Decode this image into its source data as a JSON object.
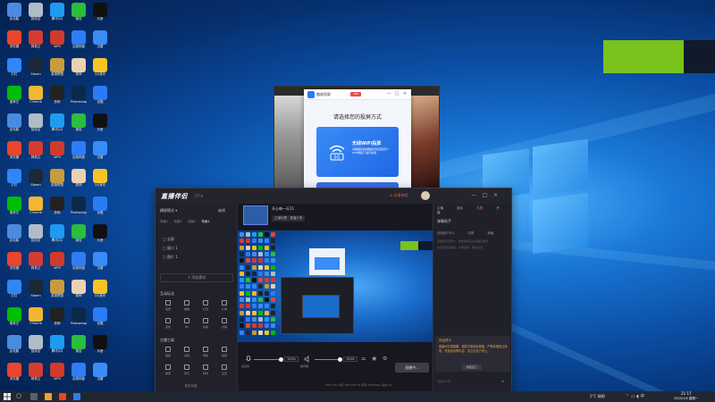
{
  "colors": {
    "accent_green": "#7ac21c",
    "live_red": "#f06a4a",
    "projection_blue": "#2a7cf6",
    "welcome_orange": "#f0a23a"
  },
  "projection_app": {
    "name": "傲软投屏",
    "badge": "VIP",
    "prompt": "请选择您的投屏方式",
    "card_title": "无线WiFi投屏",
    "card_desc": "请确保您的电脑和手机连接同一WiFi网络下进行投屏",
    "card_icon_label": "5G",
    "controls": [
      "—",
      "□",
      "×"
    ]
  },
  "live_app": {
    "logo": "直播伴侣",
    "version": "V7.6",
    "titlebar_item": "⊙ 分享伴侣",
    "controls": [
      "—",
      "□",
      "×"
    ],
    "left": {
      "scene_header": "横屏模式 ▾",
      "scene_header_right": "编辑",
      "scene_tabs": [
        "场景1",
        "场景2",
        "场景3",
        "场景4"
      ],
      "sources": [
        "▢ 全屏",
        "▢ 窗口 1",
        "▢ 图片 1"
      ],
      "add_source": "+ 添加素材",
      "interactive_title": "互动玩法",
      "interactive_tools": [
        "贴纸",
        "福袋",
        "红包",
        "礼物",
        "连线",
        "PK",
        "投票",
        "点歌"
      ],
      "anchor_title": "主播工具",
      "anchor_tools": [
        "美颜",
        "滤镜",
        "录制",
        "截屏",
        "弹幕",
        "音乐",
        "特效",
        "设置"
      ],
      "more_tools": "··· 更多功能"
    },
    "center": {
      "tab": "开心每一天11",
      "bar": "主播标题 · 直播分类",
      "mic_label": "麦克风",
      "mic_pct": "100%",
      "speaker_label": "扬声器",
      "speaker_pct": "100%",
      "start_button": "直播中...",
      "status": "CPU 23%   内存 46%   FPS 30   码率 2500kbps   丢帧 0%"
    },
    "right": {
      "tabs": [
        "主播",
        "观众",
        "礼物",
        "开播"
      ],
      "header": "弹幕助手",
      "subtabs": [
        "在线用户(0)",
        "礼物",
        "贡献"
      ],
      "line1": "直播间暂无用户，快去邀请好友来看直播吧",
      "line2": "欢迎来到直播间，文明发言，理性交流",
      "welcome_title": "欢迎提示",
      "welcome_text": "直播间文明提醒：倡导文明绿色直播，严禁传播违法违规、低俗色情等内容，请注意言行举止。",
      "welcome_button": "我知道了",
      "input_placeholder": "说点什么吧...",
      "send": "➤"
    }
  },
  "desktop_icons": [
    {
      "label": "此电脑",
      "color": "#4a8be0"
    },
    {
      "label": "回收站",
      "color": "#b0bcc8"
    },
    {
      "label": "腾讯QQ",
      "color": "#1d9bf0"
    },
    {
      "label": "微信",
      "color": "#2bbd3c"
    },
    {
      "label": "抖音",
      "color": "#111111"
    },
    {
      "label": "浏览器",
      "color": "#e8452c"
    },
    {
      "label": "网易云",
      "color": "#d43c33"
    },
    {
      "label": "WPS",
      "color": "#d23a2a"
    },
    {
      "label": "百度网盘",
      "color": "#2f7cf6"
    },
    {
      "label": "迅雷",
      "color": "#3a8cf7"
    },
    {
      "label": "钉钉",
      "color": "#2f86f6"
    },
    {
      "label": "Steam",
      "color": "#1b2838"
    },
    {
      "label": "英雄联盟",
      "color": "#c89b3c"
    },
    {
      "label": "原神",
      "color": "#e9d2b2"
    },
    {
      "label": "QQ音乐",
      "color": "#f7c325"
    },
    {
      "label": "爱奇艺",
      "color": "#00be06"
    },
    {
      "label": "Chrome",
      "color": "#f2b632"
    },
    {
      "label": "剪映",
      "color": "#222222"
    },
    {
      "label": "Photoshop",
      "color": "#0b2a4a"
    },
    {
      "label": "优酷",
      "color": "#2a7cf6"
    }
  ],
  "taskbar": {
    "tray_text": "5°C 晴朗",
    "time": "21:17",
    "date": "2020/1/6 星期一"
  }
}
